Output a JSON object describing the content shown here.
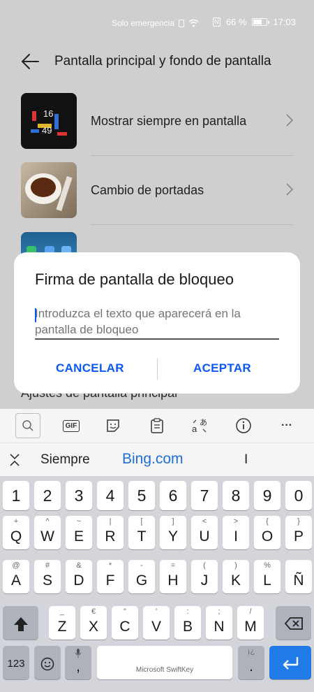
{
  "status_bar": {
    "carrier_text": "Solo emergencia",
    "battery_percent": "66 %",
    "battery_level": 0.66,
    "time": "17:03"
  },
  "app_bar": {
    "title": "Pantalla principal y fondo de pantalla"
  },
  "settings_list": [
    {
      "label": "Mostrar siempre en pantalla",
      "clock_hours": "16",
      "clock_minutes": "49"
    },
    {
      "label": "Cambio de portadas"
    },
    {
      "label": ""
    }
  ],
  "peek_label": "Ajustes de pantalla principal",
  "dialog": {
    "title": "Firma de pantalla de bloqueo",
    "placeholder": "Introduzca el texto que aparecerá en la pantalla de bloqueo",
    "cancel_label": "CANCELAR",
    "accept_label": "ACEPTAR"
  },
  "keyboard": {
    "toolbar": {
      "gif_label": "GIF",
      "more_label": "···"
    },
    "suggestions": [
      "Siempre",
      "Bing.com",
      "I"
    ],
    "number_row": [
      "1",
      "2",
      "3",
      "4",
      "5",
      "6",
      "7",
      "8",
      "9",
      "0"
    ],
    "row1": [
      {
        "main": "Q",
        "sub": "+"
      },
      {
        "main": "W",
        "sub": "^"
      },
      {
        "main": "E",
        "sub": "~"
      },
      {
        "main": "R",
        "sub": "|"
      },
      {
        "main": "T",
        "sub": "["
      },
      {
        "main": "Y",
        "sub": "]"
      },
      {
        "main": "U",
        "sub": "<"
      },
      {
        "main": "I",
        "sub": ">"
      },
      {
        "main": "O",
        "sub": "{"
      },
      {
        "main": "P",
        "sub": "}"
      }
    ],
    "row2": [
      {
        "main": "A",
        "sub": "@"
      },
      {
        "main": "S",
        "sub": "#"
      },
      {
        "main": "D",
        "sub": "&"
      },
      {
        "main": "F",
        "sub": "*"
      },
      {
        "main": "G",
        "sub": "-"
      },
      {
        "main": "H",
        "sub": "="
      },
      {
        "main": "J",
        "sub": "("
      },
      {
        "main": "K",
        "sub": ")"
      },
      {
        "main": "L",
        "sub": "%"
      },
      {
        "main": "Ñ",
        "sub": ""
      }
    ],
    "row3": [
      {
        "main": "Z",
        "sub": "_"
      },
      {
        "main": "X",
        "sub": "€"
      },
      {
        "main": "C",
        "sub": "\""
      },
      {
        "main": "V",
        "sub": "'"
      },
      {
        "main": "B",
        "sub": ":"
      },
      {
        "main": "N",
        "sub": ";"
      },
      {
        "main": "M",
        "sub": "/"
      }
    ],
    "bottom": {
      "numbers_label": "123",
      "comma_label": ",",
      "space_label": "Microsoft SwiftKey",
      "period_label": ".",
      "period_sub": "¡¿"
    }
  },
  "colors": {
    "accent": "#0a59f7",
    "enter_key": "#1e7be8"
  }
}
